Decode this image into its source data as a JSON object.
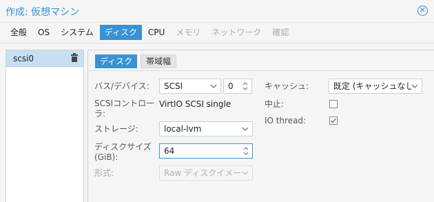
{
  "window": {
    "title": "作成: 仮想マシン",
    "close_icon": "close-circle-icon"
  },
  "wizard_tabs": [
    {
      "label": "全般",
      "state": "normal"
    },
    {
      "label": "OS",
      "state": "normal"
    },
    {
      "label": "システム",
      "state": "normal"
    },
    {
      "label": "ディスク",
      "state": "active"
    },
    {
      "label": "CPU",
      "state": "normal"
    },
    {
      "label": "メモリ",
      "state": "disabled"
    },
    {
      "label": "ネットワーク",
      "state": "disabled"
    },
    {
      "label": "確認",
      "state": "disabled"
    }
  ],
  "disks": [
    {
      "label": "scsi0",
      "action_icon": "trash-icon"
    }
  ],
  "subtabs": {
    "disk": "ディスク",
    "bandwidth": "帯域幅"
  },
  "form": {
    "bus_label": "バス/デバイス:",
    "bus_value": "SCSI",
    "device_value": "0",
    "controller_label": "SCSIコントローラ:",
    "controller_value": "VirtIO SCSI single",
    "storage_label": "ストレージ:",
    "storage_value": "local-lvm",
    "size_label": "ディスクサイズ (GiB):",
    "size_value": "64",
    "format_label": "形式:",
    "format_value": "Raw ディスクイメー",
    "cache_label": "キャッシュ:",
    "cache_value": "既定 (キャッシュなし",
    "discard_label": "中止:",
    "discard_checked": false,
    "iothread_label": "IO thread:",
    "iothread_checked": true
  },
  "colors": {
    "accent": "#3892d4",
    "selected_row": "#c8dff3"
  }
}
